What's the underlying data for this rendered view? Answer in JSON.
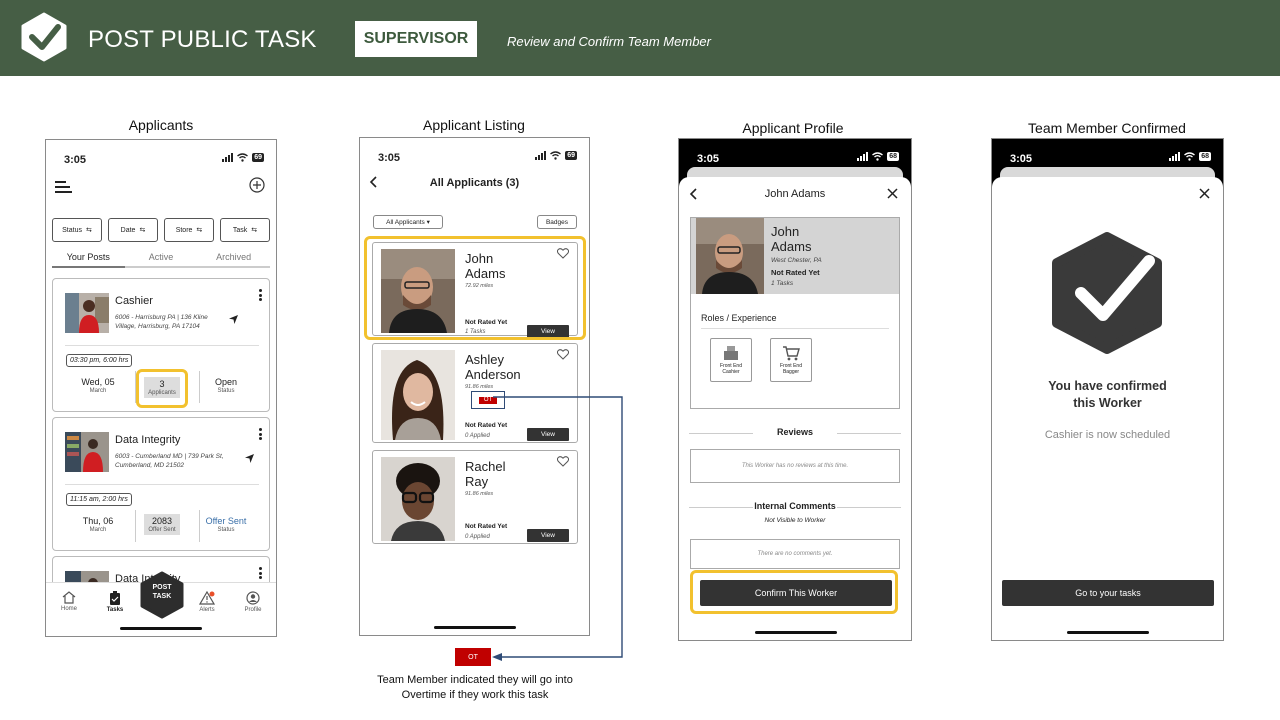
{
  "banner": {
    "title": "POST PUBLIC TASK",
    "role": "SUPERVISOR",
    "subtitle": "Review and Confirm Team Member"
  },
  "status_time": "3:05",
  "battery": "69",
  "battery_alt": "68",
  "panels": {
    "applicants": {
      "label": "Applicants",
      "filters": [
        "Status",
        "Date",
        "Store",
        "Task"
      ],
      "tabs": [
        "Your Posts",
        "Active",
        "Archived"
      ],
      "cards": [
        {
          "title": "Cashier",
          "address": "6006 - Harrisburg PA | 136 Kline Village, Harrisburg, PA 17104",
          "time": "03:30 pm, 6:00 hrs",
          "date_value": "Wed, 05",
          "date_label": "March",
          "count_value": "3",
          "count_label": "Applicants",
          "status_value": "Open",
          "status_label": "Status"
        },
        {
          "title": "Data Integrity",
          "address": "6003 - Cumberland MD | 739 Park St, Cumberland, MD 21502",
          "time": "11:15 am, 2:00 hrs",
          "date_value": "Thu, 06",
          "date_label": "March",
          "count_value": "2083",
          "count_label": "Offer Sent",
          "status_value": "Offer Sent",
          "status_label": "Status"
        },
        {
          "title": "Data Integrity"
        }
      ],
      "nav": [
        "Home",
        "Tasks",
        "Alerts",
        "Profile"
      ],
      "post_button": [
        "POST",
        "TASK"
      ]
    },
    "listing": {
      "label": "Applicant Listing",
      "title": "All Applicants (3)",
      "filter": "All Applicants ▾",
      "badges": "Badges",
      "view_label": "View",
      "ot_label": "OT",
      "applicants": [
        {
          "first": "John",
          "last": "Adams",
          "miles": "72.92 miles",
          "rated": "Not Rated Yet",
          "tasks": "1 Tasks"
        },
        {
          "first": "Ashley",
          "last": "Anderson",
          "miles": "91.86 miles",
          "rated": "Not Rated Yet",
          "tasks": "0 Applied"
        },
        {
          "first": "Rachel",
          "last": "Ray",
          "miles": "91.86 miles",
          "rated": "Not Rated Yet",
          "tasks": "0 Applied"
        }
      ]
    },
    "profile": {
      "label": "Applicant Profile",
      "header": "John Adams",
      "first": "John",
      "last": "Adams",
      "location": "West Chester, PA",
      "rated": "Not Rated Yet",
      "tasks": "1 Tasks",
      "roles_heading": "Roles / Experience",
      "roles": [
        {
          "line1": "Front End",
          "line2": "Cashier"
        },
        {
          "line1": "Front End",
          "line2": "Bagger"
        }
      ],
      "reviews_heading": "Reviews",
      "reviews_empty": "This Worker has no reviews at this time.",
      "comments_heading": "Internal Comments",
      "comments_sub": "Not Visible to Worker",
      "comments_empty": "There are no comments yet.",
      "confirm_button": "Confirm This Worker"
    },
    "confirmed": {
      "label": "Team Member Confirmed",
      "line1": "You have confirmed",
      "line2": "this Worker",
      "scheduled": "Cashier is now scheduled",
      "button": "Go to your tasks"
    }
  },
  "annotation": {
    "ot_label": "OT",
    "note_line1": "Team Member indicated they will go into",
    "note_line2": "Overtime if they work this task"
  },
  "colors": {
    "banner": "#465e45",
    "highlight": "#f2c12e",
    "ot": "#c00000",
    "button_dark": "#333333"
  }
}
